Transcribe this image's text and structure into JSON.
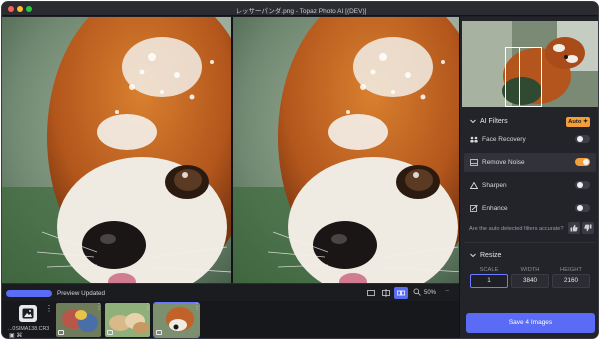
{
  "window": {
    "title": "レッサーパンダ.png - Topaz Photo AI [(DEV)]"
  },
  "toolbar": {
    "progress": 1.0,
    "status": "Preview Updated",
    "zoom": "50%",
    "zoom_minus": "−"
  },
  "strip": {
    "add_filename": "...0SIMA138.CR3",
    "kebab": "⋮",
    "thumbs": [
      {
        "name": "macaws"
      },
      {
        "name": "puppies"
      },
      {
        "name": "red panda"
      }
    ]
  },
  "panel": {
    "ai_filters_label": "AI Filters",
    "auto_label": "Auto",
    "filters": [
      {
        "label": "Face Recovery",
        "on": false
      },
      {
        "label": "Remove Noise",
        "on": true
      },
      {
        "label": "Sharpen",
        "on": false
      },
      {
        "label": "Enhance",
        "on": false
      }
    ],
    "question": "Are the auto detected filters accurate?",
    "resize_label": "Resize",
    "resize": {
      "scale_header": "SCALE",
      "width_header": "WIDTH",
      "height_header": "HEIGHT",
      "scale": "1",
      "width": "3840",
      "height": "2160"
    },
    "save_label": "Save 4 Images"
  },
  "colors": {
    "accent": "#5a6cf5",
    "orange": "#f29f3a",
    "panel_bg": "#23242a"
  }
}
